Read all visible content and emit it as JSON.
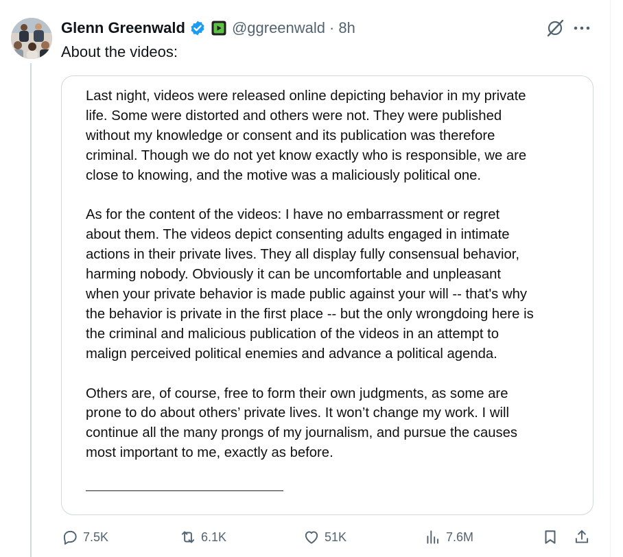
{
  "tweet": {
    "author_name": "Glenn Greenwald",
    "handle": "@ggreenwald",
    "separator": "·",
    "time": "8h",
    "text": "About the videos:"
  },
  "icons": {
    "verified": "verified-badge-icon",
    "affiliation": "rumble-affiliate-icon",
    "grok": "grok-icon",
    "more": "more-options-icon",
    "reply": "reply-icon",
    "retweet": "retweet-icon",
    "like": "like-icon",
    "views": "views-icon",
    "bookmark": "bookmark-icon",
    "share": "share-icon"
  },
  "colors": {
    "verified_blue": "#1d9bf0",
    "muted_text": "#536471",
    "affiliate_green": "#3a9f2e"
  },
  "statement": {
    "paragraphs": [
      [
        "Last night, videos were released online depicting behavior in my private",
        "life. Some were distorted and others were not. They were published",
        "without my knowledge or consent and its publication was therefore",
        "criminal. Though we do not yet know exactly who is responsible, we are",
        "close to knowing, and the motive was a maliciously political one."
      ],
      [
        "As for the content of the videos: I have no embarrassment or regret",
        "about them. The videos depict consenting adults engaged in intimate",
        "actions in their private lives. They all display fully consensual behavior,",
        "harming nobody. Obviously it can be uncomfortable and unpleasant",
        "when your private behavior is made public against your will -- that's why",
        "the behavior is private in the first place -- but the only wrongdoing here is",
        "the criminal and malicious publication of the videos in an attempt to",
        "malign perceived political enemies and advance a political agenda."
      ],
      [
        "Others are, of course, free to form their own judgments, as some are",
        "prone to do about others’ private lives. It won’t change my work. I will",
        "continue all the many prongs of my journalism, and pursue the causes",
        "most important to me, exactly as before."
      ]
    ]
  },
  "actions": {
    "replies": "7.5K",
    "retweets": "6.1K",
    "likes": "51K",
    "views": "7.6M"
  }
}
